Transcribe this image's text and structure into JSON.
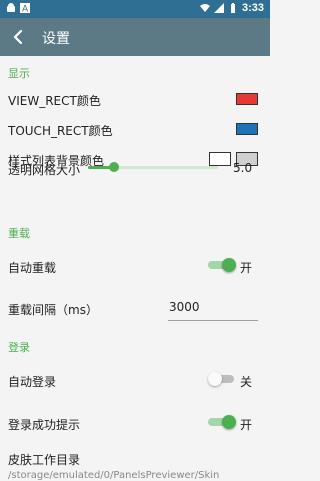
{
  "status_bar": {
    "left_icons": [
      "android-icon",
      "a-notification-icon"
    ],
    "right_icons": [
      "wifi-icon",
      "signal-icon",
      "battery-icon"
    ],
    "time": "3:33"
  },
  "app_bar": {
    "title": "设置"
  },
  "sections": {
    "display": {
      "header": "显示",
      "view_rect_label": "VIEW_RECT颜色",
      "view_rect_color": "#e53935",
      "touch_rect_label": "TOUCH_RECT颜色",
      "touch_rect_color": "#1e73b8",
      "list_bg_label": "样式列表背景颜色",
      "list_bg_colors": [
        "#ffffff",
        "#cfcfcf"
      ],
      "grid_label": "透明网格大小",
      "grid_value": "5.0",
      "grid_slider_fraction": 0.2
    },
    "reload": {
      "header": "重载",
      "auto_reload_label": "自动重载",
      "auto_reload_state": "开",
      "interval_label": "重载间隔（ms）",
      "interval_value": "3000"
    },
    "login": {
      "header": "登录",
      "auto_login_label": "自动登录",
      "auto_login_state": "关",
      "login_tip_label": "登录成功提示",
      "login_tip_state": "开"
    },
    "skin": {
      "dir_label": "皮肤工作目录",
      "dir_path": "/storage/emulated/0/PanelsPreviewer/Skin"
    }
  }
}
